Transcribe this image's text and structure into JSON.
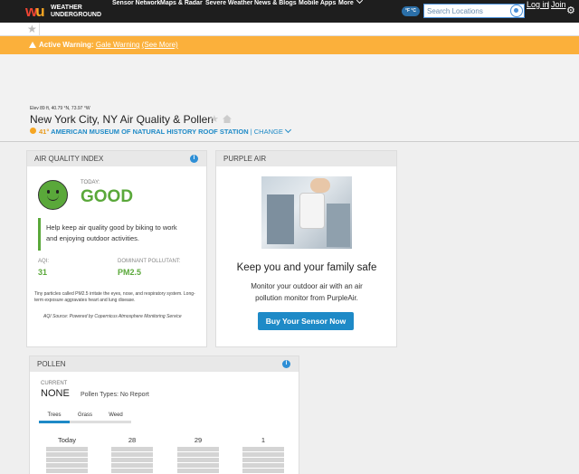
{
  "nav": {
    "logo_text": "WEATHER UNDERGROUND",
    "items": [
      "Sensor Network",
      "Maps & Radar",
      "Severe Weather",
      "News & Blogs",
      "Mobile Apps",
      "More"
    ],
    "unit_toggle": "°F °C",
    "search_placeholder": "Search Locations",
    "login": "Log in",
    "separator": "|",
    "join": "Join"
  },
  "warning": {
    "prefix": "Active Warning:",
    "link": "Gale Warning",
    "see_more": "(See More)"
  },
  "location": {
    "elevation": "Elev 89 ft, 40.79 °N, 73.97 °W",
    "title": "New York City, NY Air Quality & Pollen",
    "temp": "41°",
    "station": "AMERICAN MUSEUM OF NATURAL HISTORY ROOF STATION",
    "change": "| CHANGE"
  },
  "aqi": {
    "header": "AIR QUALITY INDEX",
    "today_label": "TODAY:",
    "status": "GOOD",
    "advice": "Help keep air quality good by biking to work and enjoying outdoor activities.",
    "aqi_label": "AQI:",
    "aqi_value": "31",
    "pollutant_label": "DOMINANT POLLUTANT:",
    "pollutant_value": "PM2.5",
    "note": "Tiny particles called PM2.5 irritate the eyes, nose, and respiratory system. Long-term exposure aggravates heart and lung disease.",
    "source": "AQI Source: Powered by Copernicus Atmosphere Monitoring Service"
  },
  "purpleair": {
    "header": "PURPLE AIR",
    "headline": "Keep you and your family safe",
    "body": "Monitor your outdoor air with an air pollution monitor from PurpleAir.",
    "button": "Buy Your Sensor Now"
  },
  "pollen": {
    "header": "POLLEN",
    "current_label": "CURRENT",
    "current_value": "NONE",
    "types_label": "Pollen Types:",
    "types_value": "No Report",
    "tabs": [
      "Trees",
      "Grass",
      "Weed"
    ],
    "days": [
      "Today",
      "28",
      "29",
      "1"
    ]
  },
  "colors": {
    "good": "#5aa83a",
    "accent": "#1e8ac7",
    "warning": "#fbb03b"
  }
}
